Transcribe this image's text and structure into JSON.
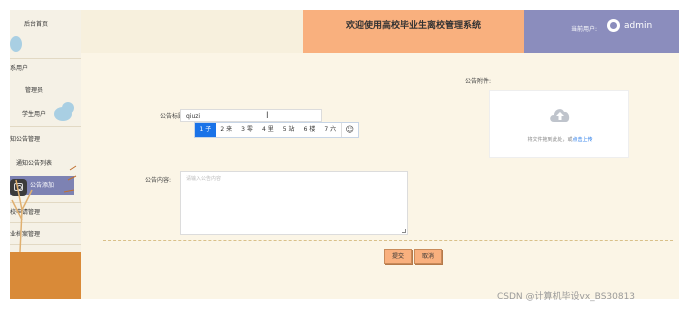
{
  "sidebar": {
    "home": "后台首页",
    "groups": [
      {
        "label": "系用户",
        "items": [
          "管理员",
          "学生用户"
        ]
      },
      {
        "label": "知公告管理",
        "items": [
          "通知公告列表",
          "公告添加"
        ]
      },
      {
        "label": "校申请管理",
        "items": []
      },
      {
        "label": "业档案管理",
        "items": []
      }
    ]
  },
  "header": {
    "title": "欢迎使用高校毕业生离校管理系统",
    "user_label": "当前用户:",
    "user_name": "admin"
  },
  "form": {
    "title_label": "公告标题:",
    "title_value": "qiuzi",
    "attachment_label": "公告附件:",
    "upload_hint": "将文件拖到此处，或",
    "upload_link": "点击上传",
    "content_label": "公告内容:",
    "content_placeholder": "请输入公告内容",
    "submit": "提交",
    "cancel": "取消"
  },
  "ime": {
    "candidates": [
      {
        "index": "1",
        "text": "子",
        "selected": true
      },
      {
        "index": "2",
        "text": "来"
      },
      {
        "index": "3",
        "text": "零"
      },
      {
        "index": "4",
        "text": "里"
      },
      {
        "index": "5",
        "text": "站"
      },
      {
        "index": "6",
        "text": "楼"
      },
      {
        "index": "7",
        "text": "六"
      }
    ],
    "emoji": "☺"
  },
  "watermark": "CSDN @计算机毕设vx_BS30813"
}
